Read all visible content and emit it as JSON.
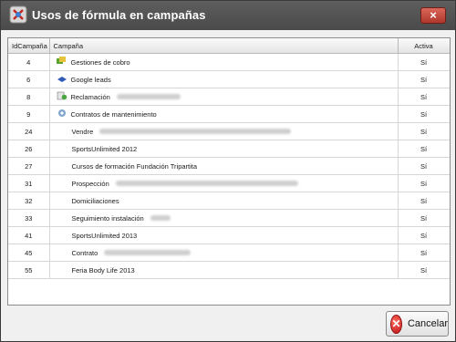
{
  "window": {
    "title": "Usos de fórmula en campañas",
    "close_glyph": "×"
  },
  "columns": {
    "id": "IdCampaña",
    "campaign": "Campaña",
    "active": "Activa"
  },
  "rows": [
    {
      "id": "4",
      "name": "Gestiones de cobro",
      "icon": "money-icon",
      "active": "Sí",
      "blur": 0
    },
    {
      "id": "6",
      "name": "Google leads",
      "icon": "google-leads-icon",
      "active": "Sí",
      "blur": 0
    },
    {
      "id": "8",
      "name": "Reclamación",
      "icon": "complaint-icon",
      "active": "Sí",
      "blur": 70
    },
    {
      "id": "9",
      "name": "Contratos de mantenimiento",
      "icon": "contract-icon",
      "active": "Sí",
      "blur": 0
    },
    {
      "id": "24",
      "name": "Vendre",
      "icon": "",
      "active": "Sí",
      "blur": 210
    },
    {
      "id": "26",
      "name": "SportsUnlimited 2012",
      "icon": "",
      "active": "Sí",
      "blur": 0
    },
    {
      "id": "27",
      "name": "Cursos de formación Fundación Tripartita",
      "icon": "",
      "active": "Sí",
      "blur": 0
    },
    {
      "id": "31",
      "name": "Prospección",
      "icon": "",
      "active": "Sí",
      "blur": 200
    },
    {
      "id": "32",
      "name": "Domiciliaciones",
      "icon": "",
      "active": "Sí",
      "blur": 0
    },
    {
      "id": "33",
      "name": "Seguimiento instalación",
      "icon": "",
      "active": "Sí",
      "blur": 22
    },
    {
      "id": "41",
      "name": "SportsUnlimited 2013",
      "icon": "",
      "active": "Sí",
      "blur": 0
    },
    {
      "id": "45",
      "name": "Contrato",
      "icon": "",
      "active": "Sí",
      "blur": 95
    },
    {
      "id": "55",
      "name": "Feria Body Life 2013",
      "icon": "",
      "active": "Sí",
      "blur": 0
    }
  ],
  "footer": {
    "cancel_label": "Cancelar"
  }
}
